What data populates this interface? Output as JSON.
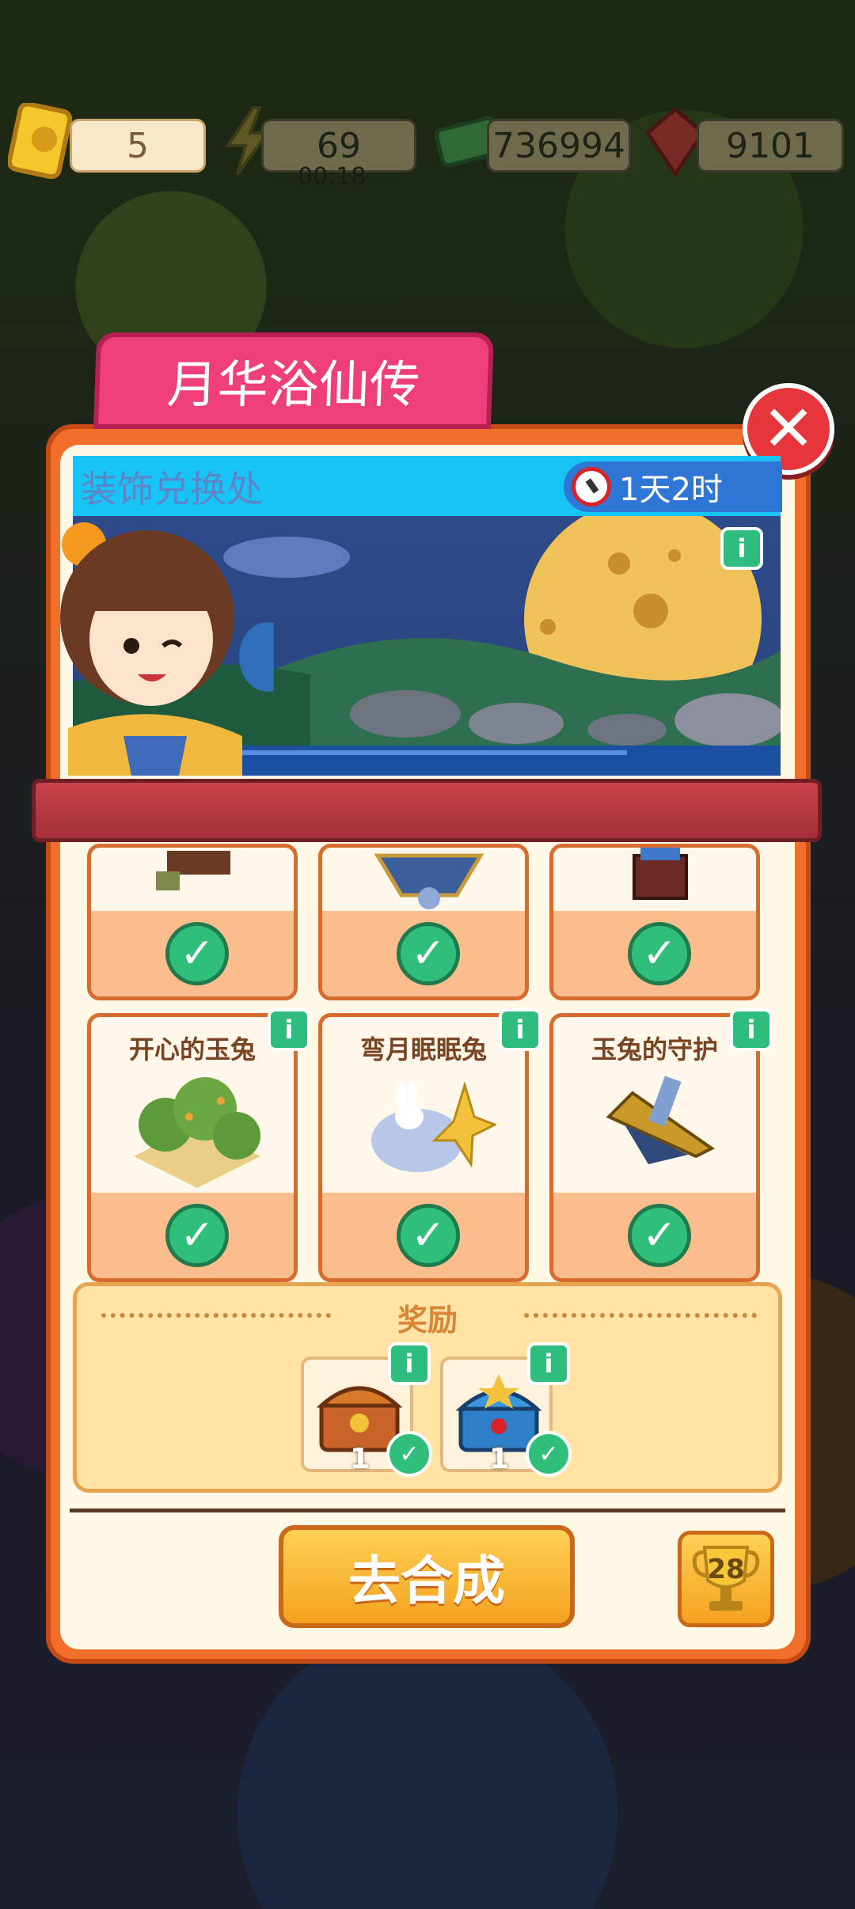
{
  "resources": {
    "tickets": "5",
    "energy": "69",
    "energy_timer": "00:18",
    "cash": "736994",
    "gems": "9101"
  },
  "event": {
    "banner_title": "月华浴仙传",
    "panel_title": "装饰兑换处",
    "time_left": "1天2时"
  },
  "items": [
    {
      "name": "",
      "completed": true
    },
    {
      "name": "",
      "completed": true
    },
    {
      "name": "",
      "completed": true
    },
    {
      "name": "开心的玉兔",
      "completed": true
    },
    {
      "name": "弯月眠眠兔",
      "completed": true
    },
    {
      "name": "玉兔的守护",
      "completed": true
    }
  ],
  "rewards": {
    "title": "奖励",
    "entries": [
      {
        "count": "1",
        "claimed": true
      },
      {
        "count": "1",
        "claimed": true
      }
    ]
  },
  "footer": {
    "go_button": "去合成",
    "trophy_count": "28"
  },
  "icons": {
    "info": "i",
    "check": "✓",
    "close": "✕"
  }
}
